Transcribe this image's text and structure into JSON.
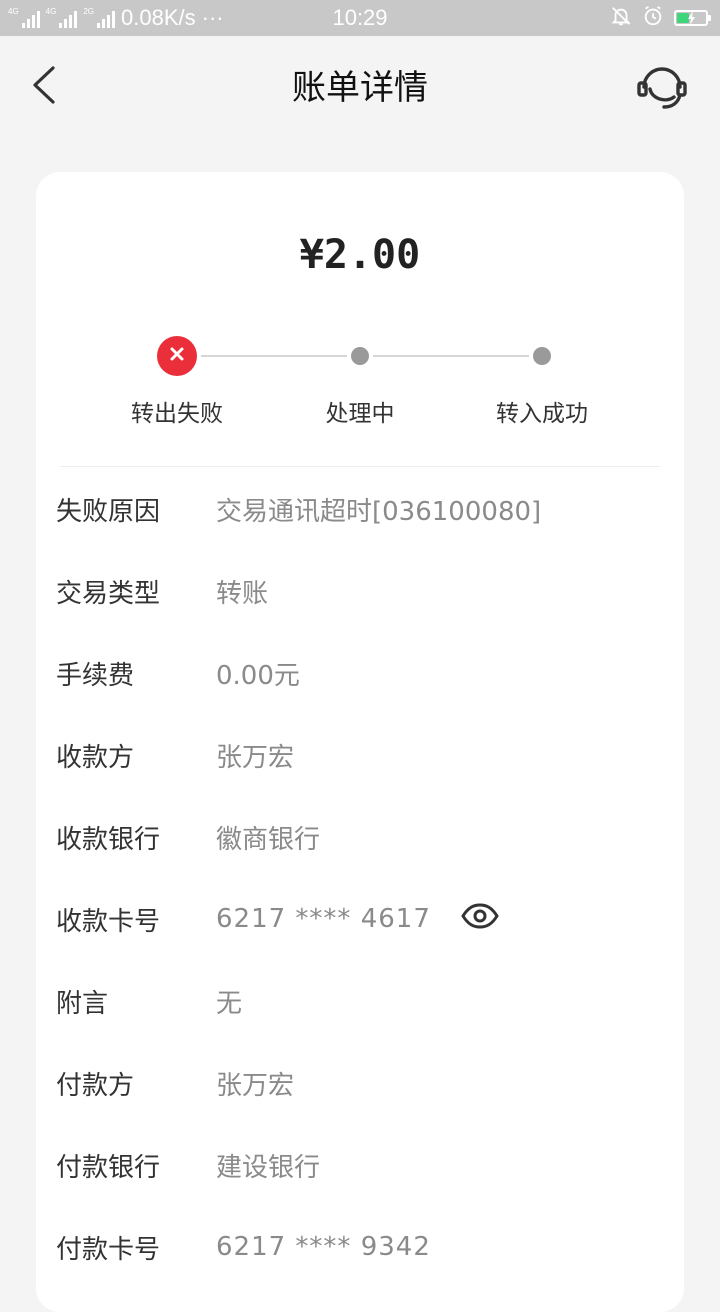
{
  "status_bar": {
    "net_speed": "0.08K/s",
    "dots": "···",
    "time": "10:29",
    "net_labels": [
      "4G",
      "4G",
      "2G"
    ],
    "battery_color": "#3fd67b"
  },
  "header": {
    "title": "账单详情",
    "back_icon": "chevron-left-icon",
    "service_icon": "headset-icon"
  },
  "summary": {
    "amount": "¥2.00",
    "steps": [
      {
        "label": "转出失败",
        "state": "failed"
      },
      {
        "label": "处理中",
        "state": "pending"
      },
      {
        "label": "转入成功",
        "state": "pending"
      }
    ],
    "fail_color": "#ea2f3a"
  },
  "details": [
    {
      "label": "失败原因",
      "value": "交易通讯超时[036100080]"
    },
    {
      "label": "交易类型",
      "value": "转账"
    },
    {
      "label": "手续费",
      "value": "0.00元"
    },
    {
      "label": "收款方",
      "value": "张万宏"
    },
    {
      "label": "收款银行",
      "value": "徽商银行"
    },
    {
      "label": "收款卡号",
      "value": "6217 **** 4617"
    },
    {
      "label": "附言",
      "value": "无"
    },
    {
      "label": "付款方",
      "value": "张万宏"
    },
    {
      "label": "付款银行",
      "value": "建设银行"
    },
    {
      "label": "付款卡号",
      "value": "6217 **** 9342"
    }
  ]
}
